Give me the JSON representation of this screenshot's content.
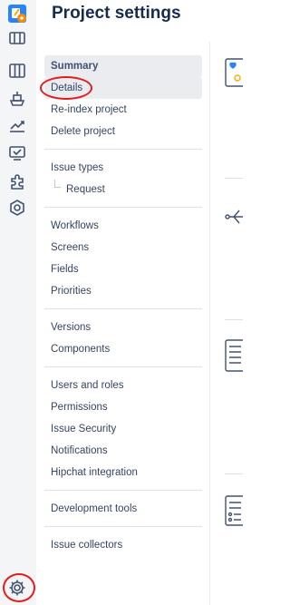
{
  "header": {
    "title": "Project settings"
  },
  "rail": {
    "items": [
      {
        "name": "project-avatar-icon"
      },
      {
        "name": "backlog-icon"
      },
      {
        "name": "board-icon"
      },
      {
        "name": "releases-icon"
      },
      {
        "name": "reports-icon"
      },
      {
        "name": "issues-icon"
      },
      {
        "name": "add-ons-icon"
      },
      {
        "name": "components-icon"
      },
      {
        "name": "settings-gear-icon"
      }
    ],
    "accent": "#0052cc"
  },
  "nav": {
    "group1": [
      "Summary",
      "Details",
      "Re-index project",
      "Delete project"
    ],
    "group2": [
      "Issue types",
      "Request"
    ],
    "group3": [
      "Workflows",
      "Screens",
      "Fields",
      "Priorities"
    ],
    "group4": [
      "Versions",
      "Components"
    ],
    "group5": [
      "Users and roles",
      "Permissions",
      "Issue Security",
      "Notifications",
      "Hipchat integration"
    ],
    "group6": [
      "Development tools"
    ],
    "group7": [
      "Issue collectors"
    ]
  },
  "colors": {
    "annotation": "#e01e1e",
    "nav_active_bg": "#ebecf0",
    "text": "#172b4d"
  }
}
